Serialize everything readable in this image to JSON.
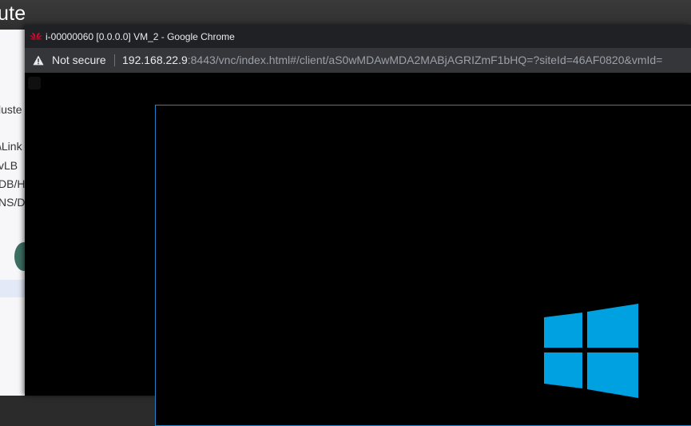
{
  "background_app": {
    "title": "ute",
    "sidebar_items": [
      "luste",
      "\\Link",
      "vLB",
      "DB/HD",
      "NS/D"
    ]
  },
  "browser": {
    "window_title": "i-00000060 [0.0.0.0] VM_2 - Google Chrome",
    "security_label": "Not secure",
    "url_host": "192.168.22.9",
    "url_rest": ":8443/vnc/index.html#/client/aS0wMDAwMDA2MABjAGRIZmF1bHQ=?siteId=46AF0820&vmId="
  },
  "colors": {
    "vnc_border": "#1f84c5",
    "windows_logo": "#00a1e0",
    "huawei_red": "#cf0a2c"
  },
  "icons": {
    "browser_favicon": "huawei-logo-icon",
    "security": "warning-triangle-icon",
    "os_logo": "windows-logo-icon"
  }
}
